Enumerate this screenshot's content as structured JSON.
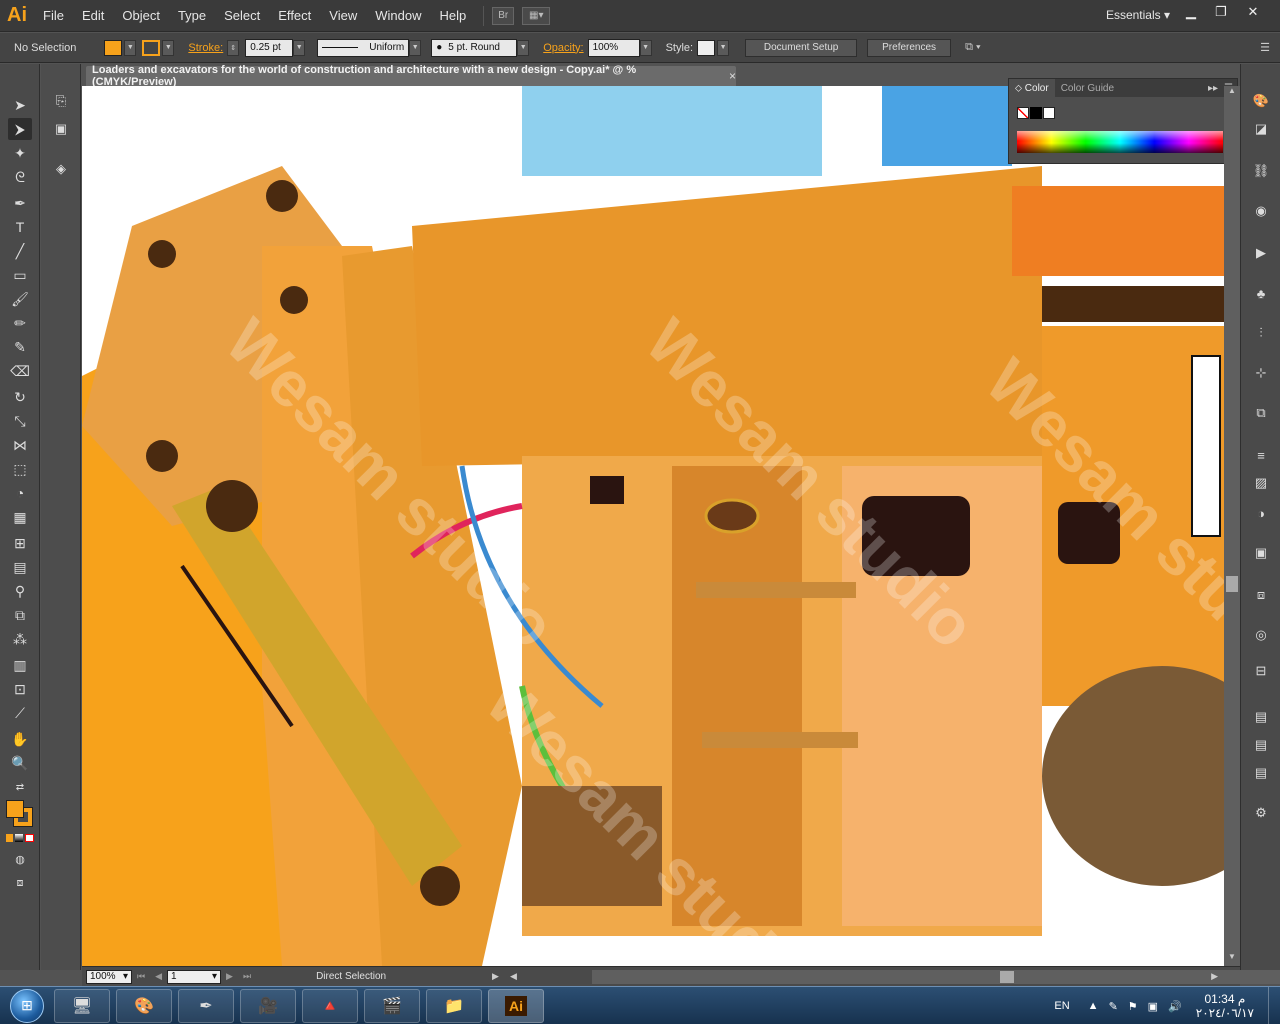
{
  "menubar": {
    "logo": "Ai",
    "items": [
      "File",
      "Edit",
      "Object",
      "Type",
      "Select",
      "Effect",
      "View",
      "Window",
      "Help"
    ],
    "bridge_button": "Br",
    "workspace": "Essentials"
  },
  "control": {
    "selection": "No Selection",
    "fill_color": "#f7a21b",
    "stroke_label": "Stroke:",
    "stroke_weight": "0.25 pt",
    "profile": "Uniform",
    "brush": "5 pt. Round",
    "opacity_label": "Opacity:",
    "opacity": "100%",
    "style_label": "Style:",
    "document_setup": "Document Setup",
    "preferences": "Preferences"
  },
  "document": {
    "tab_title": "Loaders and excavators for the world of construction and architecture with a new design - Copy.ai* @ % (CMYK/Preview)",
    "tab_close": "×"
  },
  "color_panel": {
    "tab_color": "Color",
    "tab_guide": "Color Guide"
  },
  "status": {
    "zoom": "100%",
    "artboard": "1",
    "tool": "Direct Selection"
  },
  "watermark": "Wesam studio",
  "taskbar": {
    "language": "EN",
    "time": "01:34 م",
    "date": "٢٠٢٤/٠٦/١٧"
  },
  "colors": {
    "accent": "#f7a21b",
    "canvas": "#ffffff",
    "panel": "#535353"
  }
}
